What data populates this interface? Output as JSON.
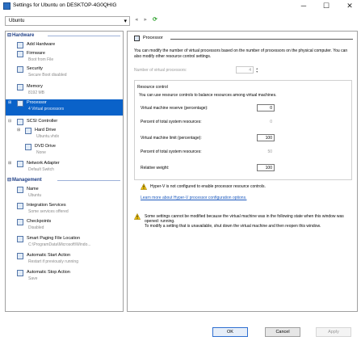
{
  "window": {
    "title": "Settings for Ubuntu on DESKTOP-4G0QHIG",
    "minimize": "─",
    "maximize": "☐",
    "close": "✕"
  },
  "toolbar": {
    "vm_selector": "Ubuntu",
    "caret": "▾",
    "back": "◂",
    "forward": "▸",
    "refresh": "⟳"
  },
  "hardware": {
    "header": "Hardware",
    "items": [
      {
        "label": "Add Hardware",
        "sub": ""
      },
      {
        "label": "Firmware",
        "sub": "Boot from File"
      },
      {
        "label": "Security",
        "sub": "Secure Boot disabled"
      },
      {
        "label": "Memory",
        "sub": "8192 MB"
      },
      {
        "label": "Processor",
        "sub": "4 Virtual processors"
      },
      {
        "label": "SCSI Controller",
        "sub": ""
      },
      {
        "label": "Hard Drive",
        "sub": "Ubuntu.vhdx"
      },
      {
        "label": "DVD Drive",
        "sub": "None"
      },
      {
        "label": "Network Adapter",
        "sub": "Default Switch"
      }
    ]
  },
  "management": {
    "header": "Management",
    "items": [
      {
        "label": "Name",
        "sub": "Ubuntu"
      },
      {
        "label": "Integration Services",
        "sub": "Some services offered"
      },
      {
        "label": "Checkpoints",
        "sub": "Disabled"
      },
      {
        "label": "Smart Paging File Location",
        "sub": "C:\\ProgramData\\Microsoft\\Windo..."
      },
      {
        "label": "Automatic Start Action",
        "sub": "Restart if previously running"
      },
      {
        "label": "Automatic Stop Action",
        "sub": "Save"
      }
    ]
  },
  "processor": {
    "title": "Processor",
    "description": "You can modify the number of virtual processors based on the number of processors on the physical computer. You can also modify other resource control settings.",
    "num_label": "Number of virtual processors:",
    "num_value": "4",
    "resource_control": {
      "header": "Resource control",
      "description": "You can use resource controls to balance resources among virtual machines.",
      "reserve_label": "Virtual machine reserve (percentage):",
      "reserve_value": "0",
      "percent_reserve_label": "Percent of total system resources:",
      "percent_reserve_value": "0",
      "limit_label": "Virtual machine limit (percentage):",
      "limit_value": "100",
      "percent_limit_label": "Percent of total system resources:",
      "percent_limit_value": "50",
      "weight_label": "Relative weight:",
      "weight_value": "100"
    },
    "hyperv_warning": "Hyper-V is not configured to enable processor resource controls.",
    "learn_more": "Learn more about Hyper-V processor configuration options.",
    "state_warning": "Some settings cannot be modified because the virtual machine was in the following state when this window was opened: running.\nTo modify a setting that is unavailable, shut down the virtual machine and then reopen this window."
  },
  "buttons": {
    "ok": "OK",
    "cancel": "Cancel",
    "apply": "Apply"
  },
  "colors": {
    "selection": "#0a62c9",
    "header": "#1f3f86",
    "link": "#1e5bbf",
    "warning": "#f2c40c"
  }
}
